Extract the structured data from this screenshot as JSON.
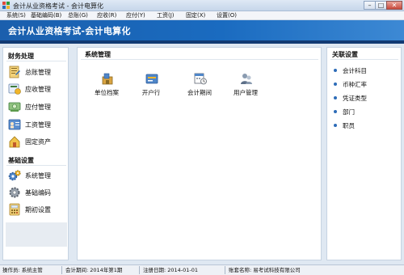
{
  "window": {
    "title": "会计从业资格考试 - 会计电算化",
    "minimize_glyph": "–",
    "restore_glyph": "□",
    "close_glyph": "✕"
  },
  "menu": [
    {
      "label": "系统(S)"
    },
    {
      "label": "基础编码(B)"
    },
    {
      "label": "总账(G)"
    },
    {
      "label": "应收(R)"
    },
    {
      "label": "应付(Y)"
    },
    {
      "label": "工资(J)"
    },
    {
      "label": "固定(X)"
    },
    {
      "label": "设置(O)"
    }
  ],
  "banner": {
    "title": "会计从业资格考试-会计电算化"
  },
  "sidebar": {
    "sections": [
      {
        "title": "财务处理",
        "items": [
          {
            "label": "总账管理",
            "icon": "ledger-icon"
          },
          {
            "label": "应收管理",
            "icon": "receivable-icon"
          },
          {
            "label": "应付管理",
            "icon": "payable-icon"
          },
          {
            "label": "工资管理",
            "icon": "payroll-icon"
          },
          {
            "label": "固定资产",
            "icon": "fixed-assets-icon"
          }
        ]
      },
      {
        "title": "基础设置",
        "items": [
          {
            "label": "系统管理",
            "icon": "gears-icon"
          },
          {
            "label": "基础编码",
            "icon": "gear-icon"
          },
          {
            "label": "期初设置",
            "icon": "calculator-icon"
          }
        ]
      }
    ]
  },
  "center": {
    "title": "系统管理",
    "tiles": [
      {
        "label": "单位档案",
        "icon": "company-file-icon"
      },
      {
        "label": "开户行",
        "icon": "bank-account-icon"
      },
      {
        "label": "会计期间",
        "icon": "calendar-clock-icon"
      },
      {
        "label": "用户管理",
        "icon": "users-icon"
      }
    ]
  },
  "right_panel": {
    "title": "关联设置",
    "links": [
      {
        "label": "会计科目"
      },
      {
        "label": "币种汇率"
      },
      {
        "label": "凭证类型"
      },
      {
        "label": "部门"
      },
      {
        "label": "职员"
      }
    ]
  },
  "status": {
    "operator": "操作员: 系统主管",
    "period": "会计期间: 2014年第1期",
    "date": "注册日期: 2014-01-01",
    "account": "账套名称: 易考试科技有限公司"
  },
  "colors": {
    "banner": "#1a64b8",
    "accent": "#2d6cb8"
  }
}
